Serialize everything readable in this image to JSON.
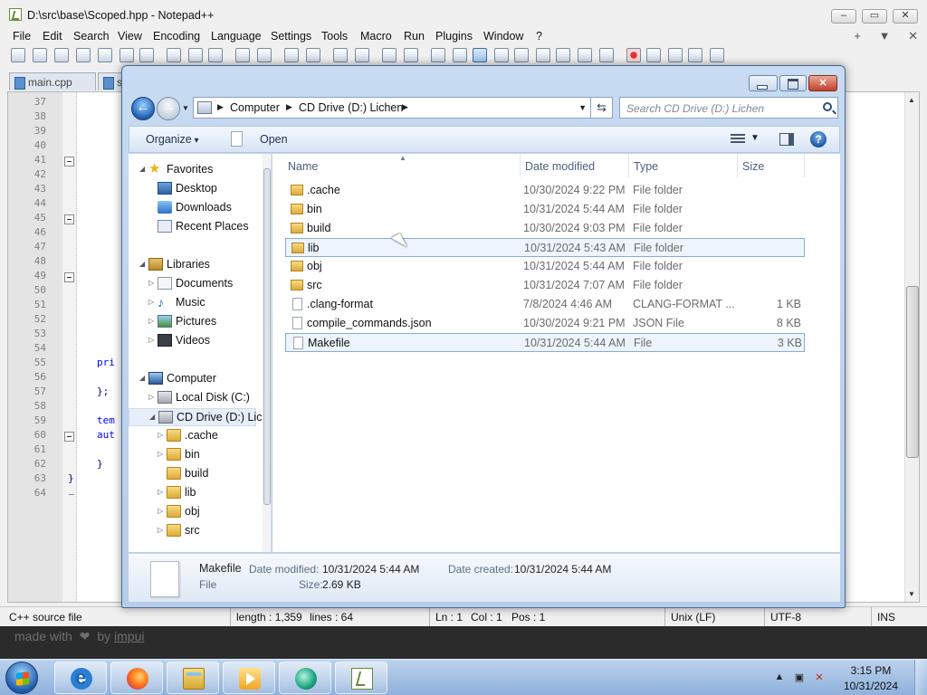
{
  "notepad": {
    "title": "D:\\src\\base\\Scoped.hpp - Notepad++",
    "menu": [
      "File",
      "Edit",
      "Search",
      "View",
      "Encoding",
      "Language",
      "Settings",
      "Tools",
      "Macro",
      "Run",
      "Plugins",
      "Window",
      "?"
    ],
    "menu_right": [
      "+",
      "▼",
      "✕"
    ],
    "tabs": [
      "main.cpp",
      "s"
    ],
    "line_numbers": [
      "37",
      "38",
      "39",
      "40",
      "41",
      "42",
      "43",
      "44",
      "45",
      "46",
      "47",
      "48",
      "49",
      "50",
      "51",
      "52",
      "53",
      "54",
      "55",
      "56",
      "57",
      "58",
      "59",
      "60",
      "61",
      "62",
      "63",
      "64"
    ],
    "code_fragments": [
      {
        "text": "pri",
        "line": "55"
      },
      {
        "text": "};",
        "line": "57"
      },
      {
        "text": "tem",
        "line": "59"
      },
      {
        "text": "aut",
        "line": "60"
      },
      {
        "text": "}",
        "line": "62"
      },
      {
        "text": "}",
        "line": "63"
      }
    ],
    "status": {
      "file_type": "C++ source file",
      "length": "length : 1,359",
      "lines": "lines : 64",
      "ln": "Ln : 1",
      "col": "Col : 1",
      "pos": "Pos : 1",
      "eol": "Unix (LF)",
      "encoding": "UTF-8",
      "mode": "INS"
    }
  },
  "overlay": {
    "made_with": "made with",
    "heart": "❤",
    "by": "by",
    "link": "impui"
  },
  "explorer": {
    "breadcrumb": [
      "Computer",
      "CD Drive (D:) Lichen"
    ],
    "search_placeholder": "Search CD Drive (D:) Lichen",
    "commands": {
      "organize": "Organize",
      "open": "Open"
    },
    "nav": {
      "favorites": "Favorites",
      "favorites_items": [
        "Desktop",
        "Downloads",
        "Recent Places"
      ],
      "libraries": "Libraries",
      "libraries_items": [
        "Documents",
        "Music",
        "Pictures",
        "Videos"
      ],
      "computer": "Computer",
      "computer_items": [
        "Local Disk (C:)",
        "CD Drive (D:) Lichen"
      ],
      "drive_folders": [
        ".cache",
        "bin",
        "build",
        "lib",
        "obj",
        "src"
      ]
    },
    "columns": [
      "Name",
      "Date modified",
      "Type",
      "Size"
    ],
    "files": [
      {
        "name": ".cache",
        "date": "10/30/2024 9:22 PM",
        "type": "File folder",
        "size": "",
        "kind": "folder"
      },
      {
        "name": "bin",
        "date": "10/31/2024 5:44 AM",
        "type": "File folder",
        "size": "",
        "kind": "folder"
      },
      {
        "name": "build",
        "date": "10/30/2024 9:03 PM",
        "type": "File folder",
        "size": "",
        "kind": "folder"
      },
      {
        "name": "lib",
        "date": "10/31/2024 5:43 AM",
        "type": "File folder",
        "size": "",
        "kind": "folder"
      },
      {
        "name": "obj",
        "date": "10/31/2024 5:44 AM",
        "type": "File folder",
        "size": "",
        "kind": "folder"
      },
      {
        "name": "src",
        "date": "10/31/2024 7:07 AM",
        "type": "File folder",
        "size": "",
        "kind": "folder"
      },
      {
        "name": ".clang-format",
        "date": "7/8/2024 4:46 AM",
        "type": "CLANG-FORMAT ...",
        "size": "1 KB",
        "kind": "file"
      },
      {
        "name": "compile_commands.json",
        "date": "10/30/2024 9:21 PM",
        "type": "JSON File",
        "size": "8 KB",
        "kind": "file"
      },
      {
        "name": "Makefile",
        "date": "10/31/2024 5:44 AM",
        "type": "File",
        "size": "3 KB",
        "kind": "file"
      }
    ],
    "details": {
      "name": "Makefile",
      "kind": "File",
      "date_modified_label": "Date modified:",
      "date_modified": "10/31/2024 5:44 AM",
      "date_created_label": "Date created:",
      "date_created": "10/31/2024 5:44 AM",
      "size_label": "Size:",
      "size": "2.69 KB"
    }
  },
  "taskbar": {
    "apps": [
      "internet-explorer",
      "firefox",
      "windows-explorer",
      "media-player",
      "app",
      "notepad-plus-plus"
    ],
    "time": "3:15 PM",
    "date": "10/31/2024"
  }
}
